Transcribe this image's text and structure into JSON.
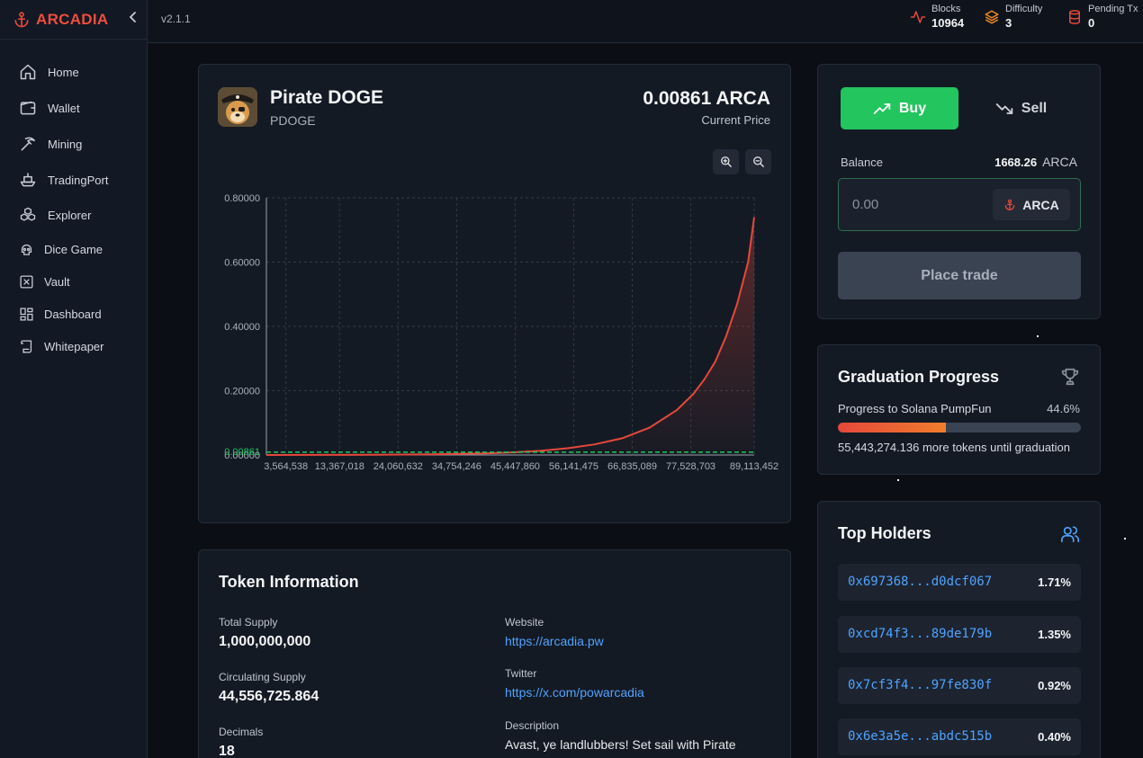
{
  "brand": {
    "name": "ARCADIA",
    "version": "v2.1.1"
  },
  "sidebar": {
    "items": [
      {
        "label": "Home",
        "icon": "home-icon"
      },
      {
        "label": "Wallet",
        "icon": "wallet-icon"
      },
      {
        "label": "Mining",
        "icon": "pickaxe-icon"
      },
      {
        "label": "TradingPort",
        "icon": "ship-icon"
      },
      {
        "label": "Explorer",
        "icon": "boxes-icon"
      },
      {
        "label": "Dice Game",
        "icon": "skull-icon"
      },
      {
        "label": "Vault",
        "icon": "vault-icon"
      },
      {
        "label": "Dashboard",
        "icon": "dashboard-icon"
      },
      {
        "label": "Whitepaper",
        "icon": "scroll-icon"
      }
    ]
  },
  "stats": {
    "blocks": {
      "label": "Blocks",
      "value": "10964"
    },
    "difficulty": {
      "label": "Difficulty",
      "value": "3"
    },
    "pending": {
      "label": "Pending Tx",
      "value": "0"
    }
  },
  "token": {
    "name": "Pirate DOGE",
    "symbol": "PDOGE",
    "price": "0.00861 ARCA",
    "price_label": "Current Price"
  },
  "chart_data": {
    "type": "line",
    "title": "",
    "xlabel": "",
    "ylabel": "",
    "x_ticks": [
      "3,564,538",
      "13,367,018",
      "24,060,632",
      "34,754,246",
      "45,447,860",
      "56,141,475",
      "66,835,089",
      "77,528,703",
      "89,113,452"
    ],
    "y_ticks": [
      "0.00000",
      "0.20000",
      "0.40000",
      "0.60000",
      "0.80000"
    ],
    "ylim": [
      0,
      0.8
    ],
    "xlim": [
      0,
      89113452
    ],
    "grid": true,
    "series": [
      {
        "color": "#e5483b",
        "x": [
          0,
          10000000,
          20000000,
          30000000,
          40000000,
          45000000,
          50000000,
          55000000,
          60000000,
          65000000,
          70000000,
          75000000,
          78000000,
          80000000,
          82000000,
          84000000,
          86000000,
          88000000,
          89113452
        ],
        "y": [
          0.0001,
          0.0003,
          0.0008,
          0.002,
          0.005,
          0.008,
          0.013,
          0.021,
          0.033,
          0.052,
          0.085,
          0.14,
          0.19,
          0.235,
          0.29,
          0.37,
          0.47,
          0.6,
          0.74
        ]
      }
    ],
    "current_price": {
      "value": "0.00861",
      "y": 0.00861,
      "color": "#22c55e"
    }
  },
  "info": {
    "title": "Token Information",
    "total_supply_label": "Total Supply",
    "total_supply": "1,000,000,000",
    "circulating_label": "Circulating Supply",
    "circulating": "44,556,725.864",
    "decimals_label": "Decimals",
    "decimals": "18",
    "website_label": "Website",
    "website": "https://arcadia.pw",
    "twitter_label": "Twitter",
    "twitter": "https://x.com/powarcadia",
    "description_label": "Description",
    "description": "Avast, ye landlubbers! Set sail with Pirate"
  },
  "trade": {
    "buy_label": "Buy",
    "sell_label": "Sell",
    "balance_label": "Balance",
    "balance_value": "1668.26",
    "balance_unit": "ARCA",
    "amount_placeholder": "0.00",
    "currency": "ARCA",
    "place_trade_label": "Place trade"
  },
  "graduation": {
    "title": "Graduation Progress",
    "label": "Progress to Solana PumpFun",
    "percent": "44.6%",
    "fraction": 0.446,
    "remaining": "55,443,274.136 more tokens until graduation"
  },
  "holders": {
    "title": "Top Holders",
    "list": [
      {
        "address": "0x697368...d0dcf067",
        "pct": "1.71%"
      },
      {
        "address": "0xcd74f3...89de179b",
        "pct": "1.35%"
      },
      {
        "address": "0x7cf3f4...97fe830f",
        "pct": "0.92%"
      },
      {
        "address": "0x6e3a5e...abdc515b",
        "pct": "0.40%"
      }
    ]
  },
  "colors": {
    "accent": "#e5483b",
    "buy": "#22c55e",
    "link": "#4fa3ff",
    "bg": "#0d1017"
  }
}
